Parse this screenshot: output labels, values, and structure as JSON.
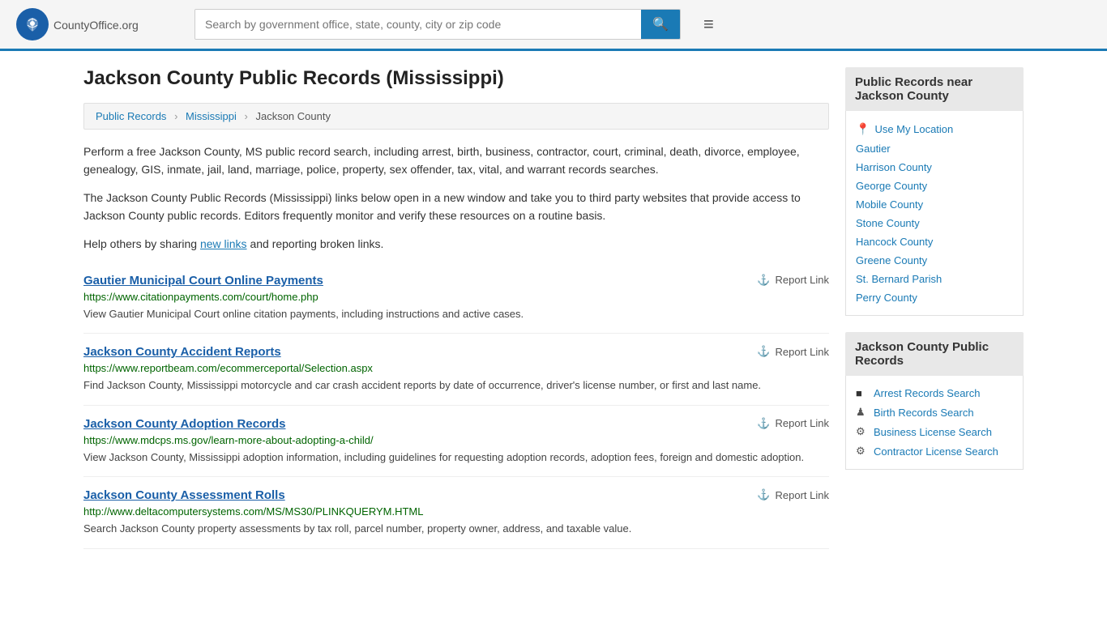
{
  "header": {
    "logo_text": "CountyOffice",
    "logo_suffix": ".org",
    "search_placeholder": "Search by government office, state, county, city or zip code",
    "search_value": ""
  },
  "page": {
    "title": "Jackson County Public Records (Mississippi)",
    "breadcrumb": [
      "Public Records",
      "Mississippi",
      "Jackson County"
    ]
  },
  "intro": {
    "para1": "Perform a free Jackson County, MS public record search, including arrest, birth, business, contractor, court, criminal, death, divorce, employee, genealogy, GIS, inmate, jail, land, marriage, police, property, sex offender, tax, vital, and warrant records searches.",
    "para2": "The Jackson County Public Records (Mississippi) links below open in a new window and take you to third party websites that provide access to Jackson County public records. Editors frequently monitor and verify these resources on a routine basis.",
    "para3_prefix": "Help others by sharing ",
    "para3_link": "new links",
    "para3_suffix": " and reporting broken links."
  },
  "records": [
    {
      "title": "Gautier Municipal Court Online Payments",
      "url": "https://www.citationpayments.com/court/home.php",
      "desc": "View Gautier Municipal Court online citation payments, including instructions and active cases.",
      "report": "Report Link"
    },
    {
      "title": "Jackson County Accident Reports",
      "url": "https://www.reportbeam.com/ecommerceportal/Selection.aspx",
      "desc": "Find Jackson County, Mississippi motorcycle and car crash accident reports by date of occurrence, driver's license number, or first and last name.",
      "report": "Report Link"
    },
    {
      "title": "Jackson County Adoption Records",
      "url": "https://www.mdcps.ms.gov/learn-more-about-adopting-a-child/",
      "desc": "View Jackson County, Mississippi adoption information, including guidelines for requesting adoption records, adoption fees, foreign and domestic adoption.",
      "report": "Report Link"
    },
    {
      "title": "Jackson County Assessment Rolls",
      "url": "http://www.deltacomputersystems.com/MS/MS30/PLINKQUERYM.HTML",
      "desc": "Search Jackson County property assessments by tax roll, parcel number, property owner, address, and taxable value.",
      "report": "Report Link"
    }
  ],
  "sidebar": {
    "nearby_title": "Public Records near Jackson County",
    "use_location": "Use My Location",
    "nearby_links": [
      "Gautier",
      "Harrison County",
      "George County",
      "Mobile County",
      "Stone County",
      "Hancock County",
      "Greene County",
      "St. Bernard Parish",
      "Perry County"
    ],
    "records_title": "Jackson County Public Records",
    "record_links": [
      {
        "icon": "■",
        "label": "Arrest Records Search"
      },
      {
        "icon": "♟",
        "label": "Birth Records Search"
      },
      {
        "icon": "⚙",
        "label": "Business License Search"
      },
      {
        "icon": "⚙",
        "label": "Contractor License Search"
      }
    ]
  }
}
